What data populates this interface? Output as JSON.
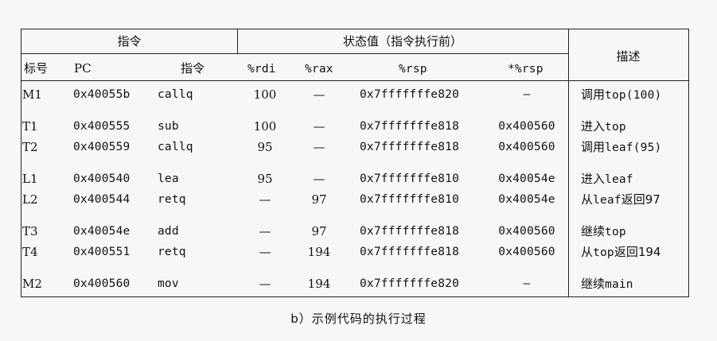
{
  "header": {
    "group_instruction": "指令",
    "group_state": "状态值（指令执行前）",
    "desc": "描述",
    "label": "标号",
    "pc": "PC",
    "instr": "指令",
    "rdi": "%rdi",
    "rax": "%rax",
    "rsp": "%rsp",
    "star_rsp": "*%rsp"
  },
  "rows": [
    {
      "label": "M1",
      "pc": "0x40055b",
      "instr": "callq",
      "rdi": "100",
      "rax": "—",
      "rsp": "0x7fffffffe820",
      "star_rsp": "—",
      "desc_a": "调用",
      "desc_b": "top(100)",
      "desc_c": ""
    },
    {
      "label": "T1",
      "pc": "0x400555",
      "instr": "sub",
      "rdi": "100",
      "rax": "—",
      "rsp": "0x7fffffffe818",
      "star_rsp": "0x400560",
      "desc_a": "进入",
      "desc_b": "top",
      "desc_c": ""
    },
    {
      "label": "T2",
      "pc": "0x400559",
      "instr": "callq",
      "rdi": "95",
      "rax": "—",
      "rsp": "0x7fffffffe818",
      "star_rsp": "0x400560",
      "desc_a": "调用",
      "desc_b": "leaf(95)",
      "desc_c": ""
    },
    {
      "label": "L1",
      "pc": "0x400540",
      "instr": "lea",
      "rdi": "95",
      "rax": "—",
      "rsp": "0x7fffffffe810",
      "star_rsp": "0x40054e",
      "desc_a": "进入",
      "desc_b": "leaf",
      "desc_c": ""
    },
    {
      "label": "L2",
      "pc": "0x400544",
      "instr": "retq",
      "rdi": "—",
      "rax": "97",
      "rsp": "0x7fffffffe810",
      "star_rsp": "0x40054e",
      "desc_a": "从",
      "desc_b": "leaf",
      "desc_c": "返回97"
    },
    {
      "label": "T3",
      "pc": "0x40054e",
      "instr": "add",
      "rdi": "—",
      "rax": "97",
      "rsp": "0x7fffffffe818",
      "star_rsp": "0x400560",
      "desc_a": "继续",
      "desc_b": "top",
      "desc_c": ""
    },
    {
      "label": "T4",
      "pc": "0x400551",
      "instr": "retq",
      "rdi": "—",
      "rax": "194",
      "rsp": "0x7fffffffe818",
      "star_rsp": "0x400560",
      "desc_a": "从",
      "desc_b": "top",
      "desc_c": "返回194"
    },
    {
      "label": "M2",
      "pc": "0x400560",
      "instr": "mov",
      "rdi": "—",
      "rax": "194",
      "rsp": "0x7fffffffe820",
      "star_rsp": "—",
      "desc_a": "继续",
      "desc_b": "main",
      "desc_c": ""
    }
  ],
  "caption": "b）示例代码的执行过程"
}
